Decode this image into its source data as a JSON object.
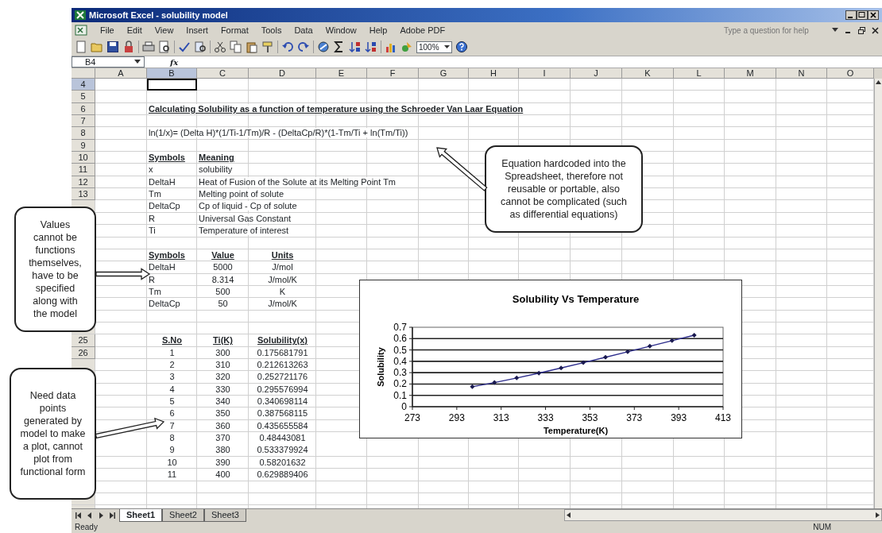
{
  "window": {
    "title": "Microsoft Excel - solubility model"
  },
  "menu": [
    "File",
    "Edit",
    "View",
    "Insert",
    "Format",
    "Tools",
    "Data",
    "Window",
    "Help",
    "Adobe PDF"
  ],
  "help_search": {
    "placeholder": "Type a question for help"
  },
  "toolbar": {
    "zoom": "100%"
  },
  "formula_bar": {
    "name_box": "B4",
    "function_label": "fx"
  },
  "columns": [
    {
      "label": "A",
      "selected": false
    },
    {
      "label": "B",
      "selected": true
    },
    {
      "label": "C",
      "selected": false
    },
    {
      "label": "D",
      "selected": false
    },
    {
      "label": "E",
      "selected": false
    },
    {
      "label": "F",
      "selected": false
    },
    {
      "label": "G",
      "selected": false
    },
    {
      "label": "H",
      "selected": false
    },
    {
      "label": "I",
      "selected": false
    },
    {
      "label": "J",
      "selected": false
    },
    {
      "label": "K",
      "selected": false
    },
    {
      "label": "L",
      "selected": false
    },
    {
      "label": "M",
      "selected": false
    },
    {
      "label": "N",
      "selected": false
    },
    {
      "label": "O",
      "selected": false
    }
  ],
  "rows": [
    {
      "number": "4",
      "selected": true,
      "kind": "plain"
    },
    {
      "number": "5",
      "selected": false,
      "kind": "plain"
    },
    {
      "number": "6",
      "selected": false,
      "kind": "heading",
      "cells": {
        "B": "Calculating Solubility as a function of temperature using the Schroeder Van Laar Equation"
      }
    },
    {
      "number": "7",
      "selected": false,
      "kind": "plain"
    },
    {
      "number": "8",
      "selected": false,
      "kind": "plain",
      "cells": {
        "B": "ln(1/x)= (Delta H)*(1/Ti-1/Tm)/R - (DeltaCp/R)*(1-Tm/Ti + ln(Tm/Ti))"
      }
    },
    {
      "number": "9",
      "selected": false,
      "kind": "plain"
    },
    {
      "number": "10",
      "selected": false,
      "kind": "heading",
      "cells": {
        "B": "Symbols",
        "C": "Meaning"
      }
    },
    {
      "number": "11",
      "selected": false,
      "kind": "plain",
      "cells": {
        "B": "x",
        "C": "solubility"
      }
    },
    {
      "number": "12",
      "selected": false,
      "kind": "plain",
      "cells": {
        "B": "DeltaH",
        "C": "Heat of Fusion of the Solute at its Melting Point Tm"
      }
    },
    {
      "number": "13",
      "selected": false,
      "kind": "plain",
      "cells": {
        "B": "Tm",
        "C": "Melting point of solute"
      }
    },
    {
      "selected": false,
      "kind": "plain",
      "cells": {
        "B": "DeltaCp",
        "C": "Cp of liquid - Cp of solute"
      }
    },
    {
      "selected": false,
      "kind": "plain",
      "cells": {
        "B": "R",
        "C": "Universal Gas Constant"
      }
    },
    {
      "selected": false,
      "kind": "plain",
      "cells": {
        "B": "Ti",
        "C": "Temperature of interest"
      }
    },
    {
      "selected": false,
      "kind": "plain"
    },
    {
      "selected": false,
      "kind": "table-heading",
      "cells": {
        "B": "Symbols",
        "C": "Value",
        "D": "Units"
      }
    },
    {
      "selected": false,
      "kind": "table",
      "cells": {
        "B": "DeltaH",
        "C": "5000",
        "D": "J/mol"
      }
    },
    {
      "selected": false,
      "kind": "table",
      "cells": {
        "B": "R",
        "C": "8.314",
        "D": "J/mol/K"
      }
    },
    {
      "selected": false,
      "kind": "table",
      "cells": {
        "B": "Tm",
        "C": "500",
        "D": "K"
      }
    },
    {
      "selected": false,
      "kind": "table",
      "cells": {
        "B": "DeltaCp",
        "C": "50",
        "D": "J/mol/K"
      }
    },
    {
      "selected": false,
      "kind": "plain"
    },
    {
      "selected": false,
      "kind": "plain"
    },
    {
      "number": "25",
      "selected": false,
      "kind": "series-heading",
      "cells": {
        "B": "S.No",
        "C": "Ti(K)",
        "D": "Solubility(x)"
      }
    },
    {
      "number": "26",
      "selected": false,
      "kind": "series",
      "cells": {
        "B": "1",
        "C": "300",
        "D": "0.175681791"
      }
    },
    {
      "selected": false,
      "kind": "series",
      "cells": {
        "B": "2",
        "C": "310",
        "D": "0.212613263"
      }
    },
    {
      "selected": false,
      "kind": "series",
      "cells": {
        "B": "3",
        "C": "320",
        "D": "0.252721176"
      }
    },
    {
      "selected": false,
      "kind": "series",
      "cells": {
        "B": "4",
        "C": "330",
        "D": "0.295576994"
      }
    },
    {
      "selected": false,
      "kind": "series",
      "cells": {
        "B": "5",
        "C": "340",
        "D": "0.340698114"
      }
    },
    {
      "selected": false,
      "kind": "series",
      "cells": {
        "B": "6",
        "C": "350",
        "D": "0.387568115"
      }
    },
    {
      "selected": false,
      "kind": "series",
      "cells": {
        "B": "7",
        "C": "360",
        "D": "0.435655584"
      }
    },
    {
      "selected": false,
      "kind": "series",
      "cells": {
        "B": "8",
        "C": "370",
        "D": "0.48443081"
      }
    },
    {
      "selected": false,
      "kind": "series",
      "cells": {
        "B": "9",
        "C": "380",
        "D": "0.533379924"
      }
    },
    {
      "selected": false,
      "kind": "series",
      "cells": {
        "B": "10",
        "C": "390",
        "D": "0.58201632"
      }
    },
    {
      "selected": false,
      "kind": "series",
      "cells": {
        "B": "11",
        "C": "400",
        "D": "0.629889406"
      }
    },
    {
      "selected": false,
      "kind": "plain"
    },
    {
      "selected": false,
      "kind": "plain"
    }
  ],
  "chart": {
    "chart_data": {
      "type": "line",
      "title": "Solubility Vs Temperature",
      "xlabel": "Temperature(K)",
      "ylabel": "Solubility",
      "x": [
        300,
        310,
        320,
        330,
        340,
        350,
        360,
        370,
        380,
        390,
        400
      ],
      "series": [
        {
          "color": "#2c2c8c",
          "marker": "diamond",
          "values": [
            0.176,
            0.213,
            0.253,
            0.296,
            0.341,
            0.388,
            0.436,
            0.484,
            0.533,
            0.582,
            0.63
          ]
        }
      ],
      "grid": true,
      "xlim": [
        273,
        413
      ],
      "ylim": [
        0,
        0.7
      ],
      "xticks": [
        273,
        293,
        313,
        333,
        353,
        373,
        393,
        413
      ],
      "yticks": [
        0,
        0.1,
        0.2,
        0.3,
        0.4,
        0.5,
        0.6,
        0.7
      ]
    }
  },
  "sheet_tabs": [
    {
      "label": "Sheet1",
      "selected": true
    },
    {
      "label": "Sheet2",
      "selected": false
    },
    {
      "label": "Sheet3",
      "selected": false
    }
  ],
  "status_bar": {
    "left": "Ready",
    "right": "NUM"
  },
  "callouts": [
    {
      "text": "Equation hardcoded into the Spreadsheet, therefore not reusable or portable, also cannot be complicated (such as differential equations)"
    },
    {
      "text": "Values cannot be functions themselves, have to be specified along with the model"
    },
    {
      "text": "Need data points generated by model to make a plot, cannot plot from functional form"
    }
  ]
}
